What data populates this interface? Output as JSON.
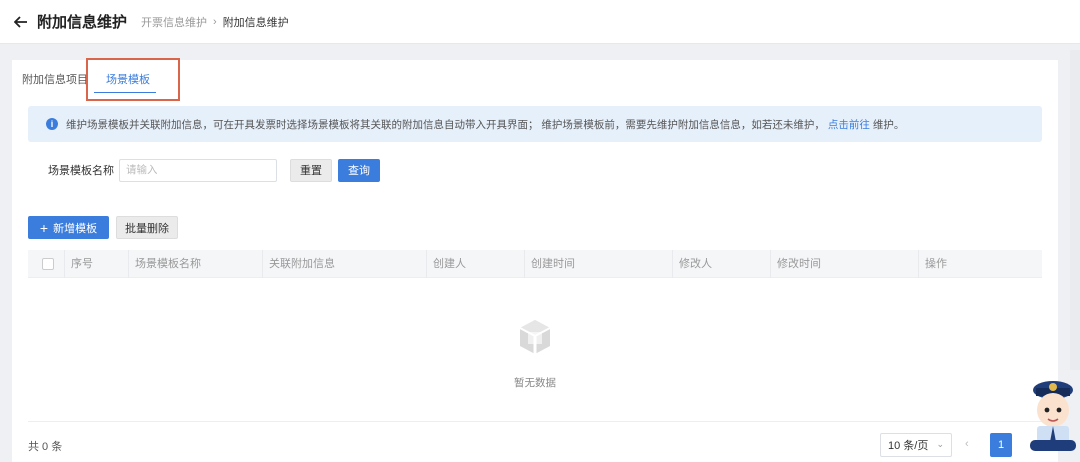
{
  "header": {
    "title": "附加信息维护",
    "breadcrumb": [
      "开票信息维护",
      "附加信息维护"
    ]
  },
  "tabs": [
    {
      "label": "附加信息项目"
    },
    {
      "label": "场景模板",
      "active": true
    }
  ],
  "notice": {
    "text": "维护场景模板并关联附加信息，可在开具发票时选择场景模板将其关联的附加信息自动带入开具界面； 维护场景模板前，需要先维护附加信息信息，如若还未维护，",
    "link": "点击前往",
    "suffix": "维护。"
  },
  "filter": {
    "label": "场景模板名称",
    "placeholder": "请输入",
    "reset": "重置",
    "query": "查询"
  },
  "actions": {
    "add": "新增模板",
    "batch_delete": "批量删除"
  },
  "table": {
    "columns": [
      "序号",
      "场景模板名称",
      "关联附加信息",
      "创建人",
      "创建时间",
      "修改人",
      "修改时间",
      "操作"
    ],
    "rows": [],
    "empty_text": "暂无数据"
  },
  "pagination": {
    "total": "共 0 条",
    "page_size": "10 条/页",
    "current_page": "1"
  },
  "colors": {
    "accent": "#3b7ddd",
    "highlight_box": "#d9664a",
    "notice_bg": "#e6f0fb"
  },
  "icons": [
    "back-arrow-icon",
    "chevron-right-icon",
    "info-icon",
    "plus-icon",
    "empty-box-icon",
    "chevron-down-icon",
    "chevron-left-icon",
    "mascot-icon"
  ]
}
